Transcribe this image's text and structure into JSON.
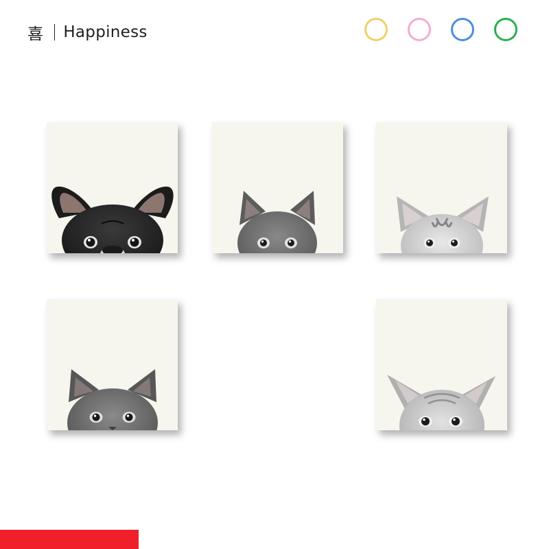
{
  "header": {
    "glyph": "喜",
    "title": "Happiness"
  },
  "colors": {
    "accent_bar": "#f0202b",
    "tile_background": "#f6f5ee",
    "text": "#1e1e1e"
  },
  "swatches": [
    {
      "name": "yellow",
      "color": "#f2cf6a"
    },
    {
      "name": "pink",
      "color": "#f5abd2"
    },
    {
      "name": "blue",
      "color": "#4a8de3"
    },
    {
      "name": "green",
      "color": "#27b14f"
    }
  ],
  "tiles": [
    {
      "animal": "french-bulldog",
      "icon": "french-bulldog-icon"
    },
    {
      "animal": "gray-cat",
      "icon": "gray-cat-icon"
    },
    {
      "animal": "tabby-kitten",
      "icon": "tabby-kitten-icon"
    },
    {
      "animal": "gray-cat",
      "icon": "gray-cat-icon"
    },
    {
      "animal": "fluffy-cat",
      "icon": "fluffy-cat-icon"
    }
  ]
}
